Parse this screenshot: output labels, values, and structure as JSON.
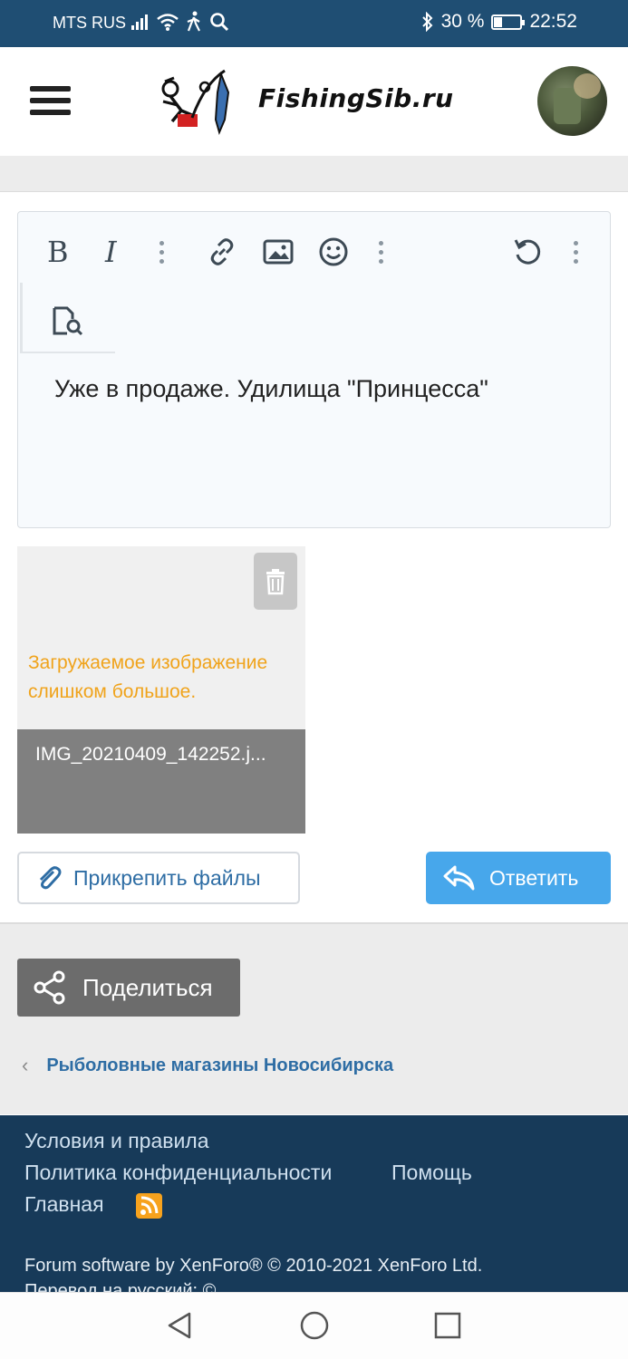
{
  "status_bar": {
    "carrier": "MTS RUS",
    "battery_text": "30 %",
    "battery_level": 0.3,
    "time": "22:52"
  },
  "header": {
    "logo_text": "FishingSib.ru"
  },
  "editor": {
    "toolbar": {
      "bold": "B",
      "italic": "I"
    },
    "content": "Уже в продаже. Удилища \"Принцесса\""
  },
  "attachment": {
    "error_text": "Загружаемое изображение слишком большое.",
    "file_name": "IMG_20210409_142252.j..."
  },
  "actions": {
    "attach_label": "Прикрепить файлы",
    "reply_label": "Ответить",
    "share_label": "Поделиться"
  },
  "breadcrumb": {
    "label": "Рыболовные магазины Новосибирска"
  },
  "footer": {
    "terms": "Условия и правила",
    "privacy": "Политика конфиденциальности",
    "help": "Помощь",
    "home": "Главная",
    "copyright": "Forum software by XenForo® © 2010-2021 XenForo Ltd.",
    "copyright2": "Перевод на русский: ©..."
  },
  "colors": {
    "status_bar": "#1f4e73",
    "link": "#2e6da4",
    "reply_button": "#47a7eb",
    "error": "#f0a31b",
    "footer": "#173a59",
    "rss": "#f7a21d"
  }
}
